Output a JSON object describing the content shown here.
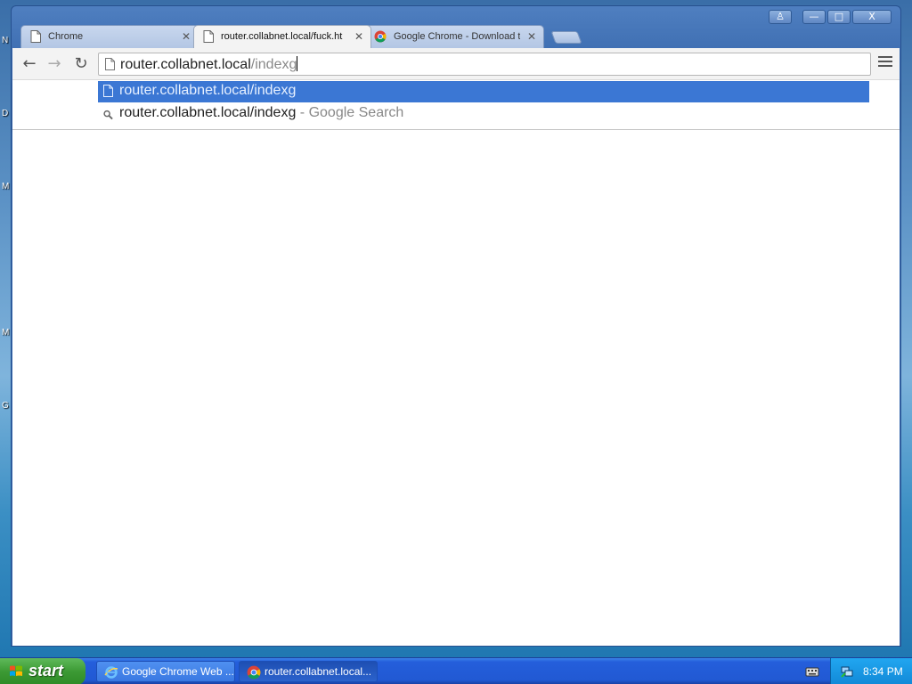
{
  "desktop": {
    "edge_letters": [
      "N",
      "D",
      "M",
      "M",
      "G"
    ]
  },
  "window": {
    "controls": {
      "profile": "♙",
      "minimize": "—",
      "maximize": "□",
      "close": "X"
    }
  },
  "tabs": [
    {
      "label": "Chrome",
      "icon": "page-icon",
      "active": false
    },
    {
      "label": "router.collabnet.local/fuck.ht",
      "icon": "page-icon",
      "active": true
    },
    {
      "label": "Google Chrome - Download t",
      "icon": "chrome-logo-icon",
      "active": false
    }
  ],
  "toolbar": {
    "back": "←",
    "forward": "→",
    "reload": "↻"
  },
  "omnibox": {
    "typed": "router.collabnet.local",
    "autocompleted": "/indexg"
  },
  "suggestions": [
    {
      "text": "router.collabnet.local/indexg",
      "description": "",
      "icon": "page-icon",
      "selected": true
    },
    {
      "text": "router.collabnet.local/indexg",
      "description": " - Google Search",
      "icon": "search-icon",
      "selected": false
    }
  ],
  "taskbar": {
    "start_label": "start",
    "tasks": [
      {
        "label": "Google Chrome Web ...",
        "icon": "ie-icon",
        "active": false
      },
      {
        "label": "router.collabnet.local...",
        "icon": "chrome-logo-icon",
        "active": true
      }
    ],
    "clock": "8:34 PM"
  },
  "colors": {
    "selection": "#3b77d4",
    "taskbar": "#245edb",
    "start": "#3c9a34"
  }
}
